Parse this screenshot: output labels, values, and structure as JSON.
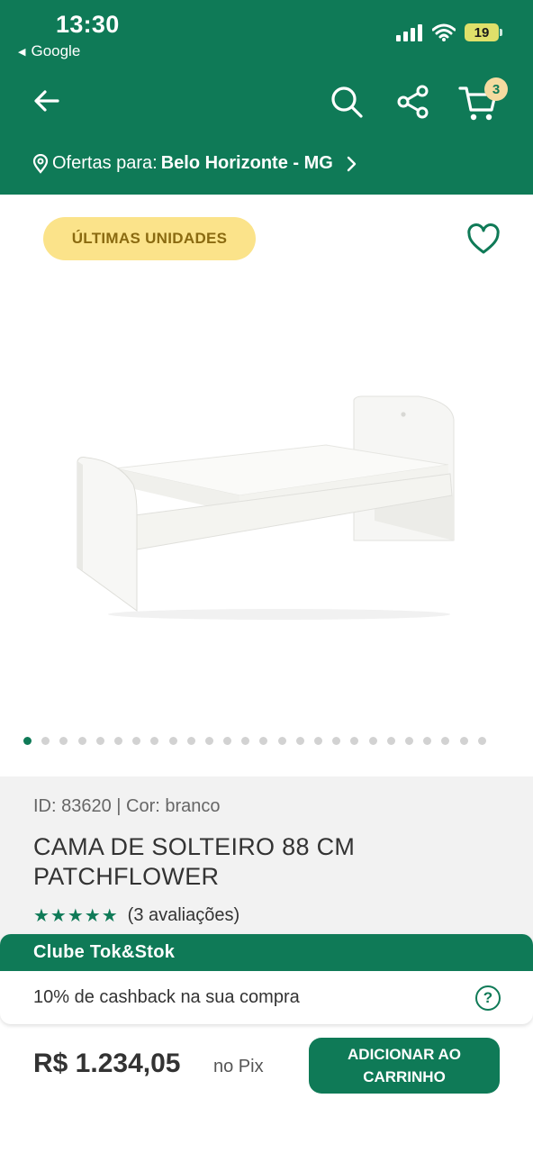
{
  "status_bar": {
    "time": "13:30",
    "back_app": "Google",
    "battery": "19"
  },
  "header": {
    "cart_count": "3",
    "location": {
      "prefix": "Ofertas para:",
      "city": "Belo Horizonte - MG"
    },
    "icons": [
      "back-arrow-icon",
      "search-icon",
      "share-icon",
      "cart-icon"
    ]
  },
  "gallery": {
    "badge": "ÚLTIMAS UNIDADES",
    "dots_total": 26,
    "active_dot": 0
  },
  "product": {
    "id_line": "ID: 83620 | Cor: branco",
    "title": "CAMA DE SOLTEIRO 88 CM PATCHFLOWER",
    "stars": "★★★★★",
    "reviews": "(3 avaliações)"
  },
  "club": {
    "title": "Clube Tok&Stok",
    "cashback": "10% de cashback na sua compra",
    "help": "?"
  },
  "footer": {
    "price": "R$ 1.234,05",
    "price_suffix": "no Pix",
    "add_button": "ADICIONAR AO CARRINHO"
  },
  "colors": {
    "brand_green": "#0f7a57",
    "badge_yellow": "#fbe38a",
    "info_bg": "#f2f2f2"
  }
}
